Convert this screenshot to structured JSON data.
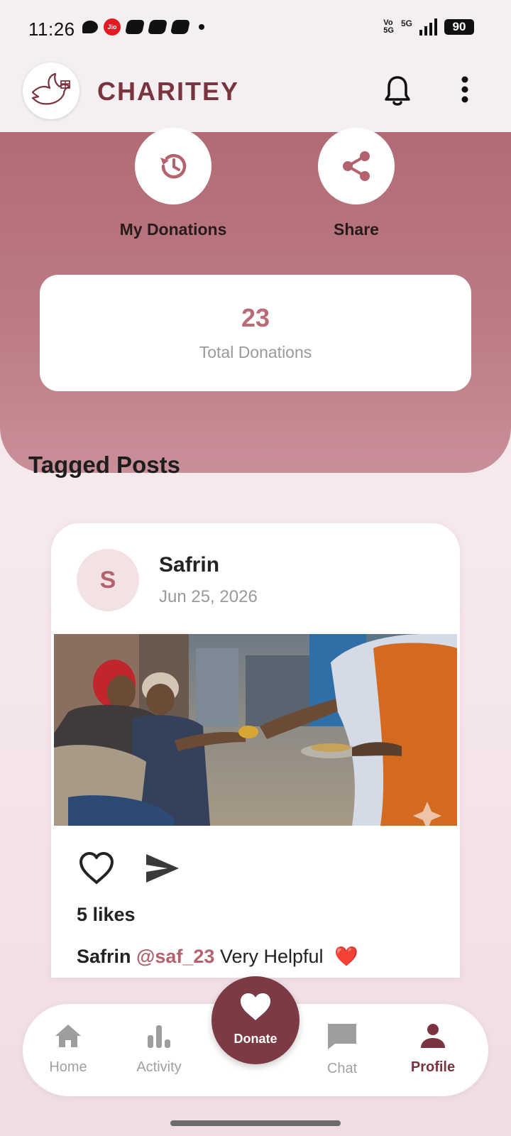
{
  "status_bar": {
    "time": "11:26",
    "carrier_badge": "Jio",
    "network": "5G",
    "battery": "90"
  },
  "app_bar": {
    "title": "CHARITEY",
    "icons": [
      "dove-logo-icon",
      "bell-icon",
      "more-vertical-icon"
    ]
  },
  "hero": {
    "actions": [
      {
        "label": "My Donations",
        "icon": "history-icon"
      },
      {
        "label": "Share",
        "icon": "share-icon"
      }
    ],
    "stat": {
      "value": "23",
      "label": "Total Donations"
    }
  },
  "section_title": "Tagged Posts",
  "post": {
    "avatar_initial": "S",
    "author": "Safrin",
    "date": "Jun 25, 2026",
    "likes": "5 likes",
    "caption_user": "Safrin",
    "caption_handle": "@saf_23",
    "caption_text": "Very Helpful",
    "caption_emoji": "❤️"
  },
  "bottom_nav": {
    "items": [
      {
        "label": "Home",
        "icon": "home-icon"
      },
      {
        "label": "Activity",
        "icon": "bar-chart-icon"
      },
      {
        "label": "Chat",
        "icon": "chat-icon"
      },
      {
        "label": "Profile",
        "icon": "person-icon",
        "active": true
      }
    ],
    "donate_label": "Donate"
  },
  "colors": {
    "brand": "#7a3440",
    "hero": "#b26b75",
    "accent": "#b4636e"
  }
}
